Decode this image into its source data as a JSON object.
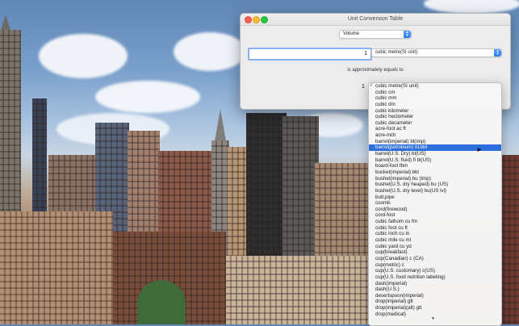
{
  "window": {
    "title": "Unit Conversion Table"
  },
  "category": {
    "selected": "Volume"
  },
  "input": {
    "value": "1"
  },
  "source_unit": {
    "selected": "cubic metre(SI unit)"
  },
  "approx_label": "is approximately equals to",
  "result": {
    "value": "1"
  },
  "menu": {
    "checked_index": 0,
    "highlighted_index": 10,
    "items": [
      "cubic metre(SI unit)",
      "cubic cm",
      "cubic mm",
      "cubic dm",
      "cubic kilometer",
      "cubic hectometer",
      "cubic decameter",
      "acre-foot ac ft",
      "acre-inch",
      "barrel(imperial) bl(imp)",
      "barrel(petroleum) bl,bbl",
      "barrel(U.S. Dry) bl(US)",
      "barrel(U.S. fluid) fl bl(US)",
      "board-foot fbm",
      "bucket(imperial) bkt",
      "bushel(imperial) bu (Imp)",
      "bushel(U.S. dry heaped) bu (US)",
      "bushel(U.S. dry level) bu(US lvl)",
      "butt,pipe",
      "coomb",
      "cord(firewood)",
      "cord-foot",
      "cubic fathom cu fm",
      "cubic foot cu ft",
      "cubic inch cu in",
      "cubic mile cu mi",
      "cubic yard cu yd",
      "cup(breakfast)",
      "cup(Canadian) c (CA)",
      "cup(metric) c",
      "cup(U.S. customary) c(US)",
      "cup(U.S. food nutrition labeling)",
      "dash(imperial)",
      "dash(U.S.)",
      "desertspoon(imperial)",
      "drop(imperial) gtt",
      "drop(imperial)(alt) gtt",
      "drop(medical)"
    ]
  },
  "colors": {
    "highlight": "#2d6fdc",
    "accent": "#2a79f0"
  }
}
